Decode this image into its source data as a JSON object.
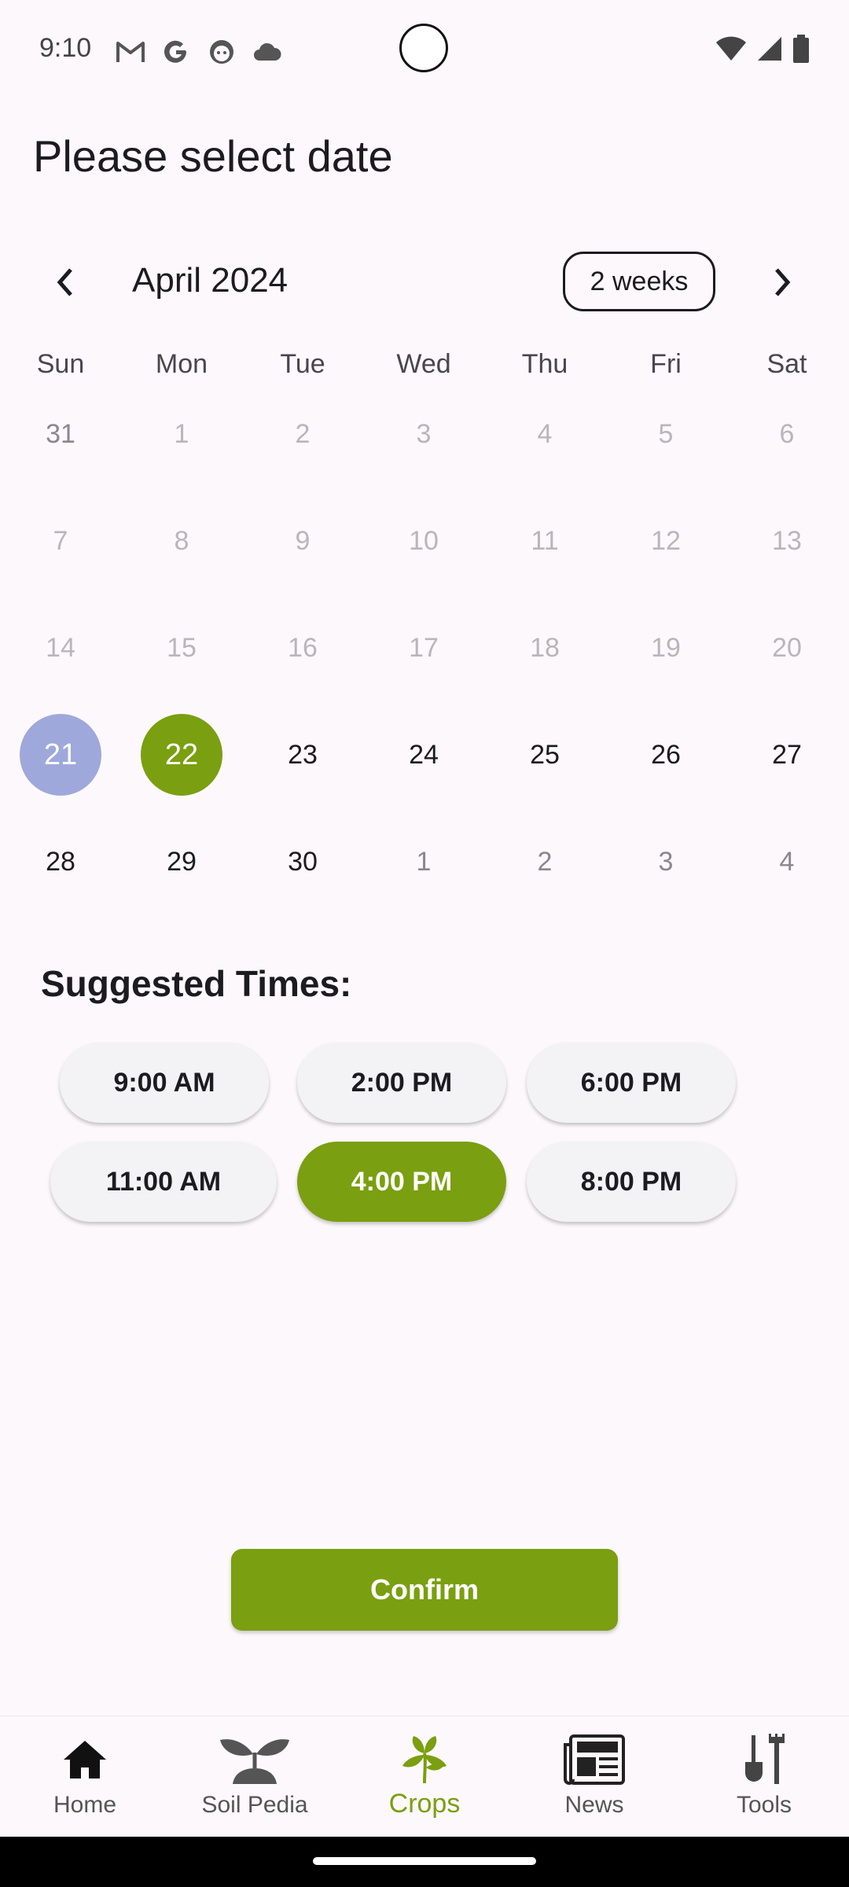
{
  "status_bar": {
    "time": "9:10",
    "icons_left": [
      "gmail-icon",
      "google-icon",
      "face-icon",
      "cloud-icon"
    ],
    "icons_right": [
      "wifi-icon",
      "signal-icon",
      "battery-icon"
    ]
  },
  "page": {
    "title": "Please select date"
  },
  "calendar": {
    "month_label": "April 2024",
    "format_button": "2 weeks",
    "weekdays": [
      "Sun",
      "Mon",
      "Tue",
      "Wed",
      "Thu",
      "Fri",
      "Sat"
    ],
    "weeks": [
      [
        "31",
        "1",
        "2",
        "3",
        "4",
        "5",
        "6"
      ],
      [
        "7",
        "8",
        "9",
        "10",
        "11",
        "12",
        "13"
      ],
      [
        "14",
        "15",
        "16",
        "17",
        "18",
        "19",
        "20"
      ],
      [
        "21",
        "22",
        "23",
        "24",
        "25",
        "26",
        "27"
      ],
      [
        "28",
        "29",
        "30",
        "1",
        "2",
        "3",
        "4"
      ]
    ],
    "today": "21",
    "selected": "22",
    "colors": {
      "today": "#9fa8da",
      "selected": "#7a9f10",
      "disabled": "#b9b6bb"
    }
  },
  "suggested_times": {
    "title": "Suggested Times:",
    "rows": [
      [
        "9:00 AM",
        "2:00 PM",
        "6:00 PM"
      ],
      [
        "11:00 AM",
        "4:00 PM",
        "8:00 PM"
      ]
    ],
    "selected": "4:00 PM",
    "accent": "#7a9f10"
  },
  "confirm_label": "Confirm",
  "bottom_nav": {
    "items": [
      {
        "label": "Home",
        "icon": "home-icon"
      },
      {
        "label": "Soil Pedia",
        "icon": "sprout-icon"
      },
      {
        "label": "Crops",
        "icon": "crops-icon"
      },
      {
        "label": "News",
        "icon": "newspaper-icon"
      },
      {
        "label": "Tools",
        "icon": "tools-icon"
      }
    ],
    "active": "Crops"
  }
}
